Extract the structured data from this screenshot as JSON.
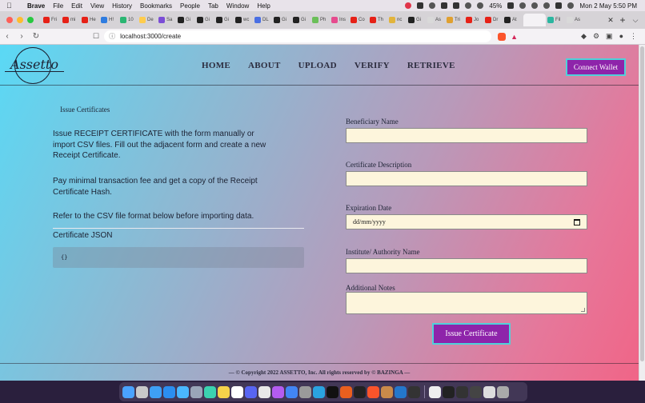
{
  "menubar": {
    "app": "Brave",
    "items": [
      "File",
      "Edit",
      "View",
      "History",
      "Bookmarks",
      "People",
      "Tab",
      "Window",
      "Help"
    ],
    "battery": "45%",
    "datetime": "Mon 2 May  5:50 PM"
  },
  "browser": {
    "tab_labels": [
      "Fri",
      "mi",
      "He",
      "H!",
      "10",
      "De",
      "Sa",
      "Gi",
      "Gi",
      "Gi",
      "wc",
      "DL",
      "Gi",
      "Gi",
      "Ph",
      "Ins",
      "Co",
      "Th",
      "nc",
      "Gi",
      "As",
      "Tri",
      "Jo",
      "Dr",
      "At",
      "",
      "Fil",
      "As"
    ],
    "tab_colors": [
      "#e62117",
      "#e62117",
      "#e62117",
      "#2f7ce0",
      "#2bb673",
      "#ffcc4d",
      "#7b4dd6",
      "#222222",
      "#222222",
      "#222222",
      "#222222",
      "#4a6fe3",
      "#222222",
      "#222222",
      "#6bbf59",
      "#e64b8e",
      "#e62117",
      "#e62117",
      "#e2b43c",
      "#222222",
      "#d9d9d9",
      "#e0a030",
      "#e62117",
      "#e62117",
      "#222222",
      "#f4f2f5",
      "#2bb6a0",
      "#d9d9d9"
    ],
    "url": "localhost:3000/create"
  },
  "navbar": {
    "logo_text": "Assetto",
    "links": [
      "HOME",
      "ABOUT",
      "UPLOAD",
      "VERIFY",
      "RETRIEVE"
    ],
    "connect_label": "Connect Wallet"
  },
  "left": {
    "title": "Issue Certificates",
    "p1": "Issue RECEIPT CERTIFICATE with the form manually or import CSV files. Fill out the adjacent form and create a new Receipt Certificate.",
    "p2": "Pay minimal transaction fee and get a copy of the Receipt Certificate Hash.",
    "p3": "Refer to the CSV file format below before importing data.",
    "json_label": "Certificate JSON",
    "json_value": "{}"
  },
  "form": {
    "beneficiary_label": "Beneficiary Name",
    "beneficiary_value": "",
    "description_label": "Certificate Description",
    "description_value": "",
    "expiration_label": "Expiration Date",
    "expiration_placeholder": "dd/mm/yyyy",
    "institute_label": "Institute/ Authority Name",
    "institute_value": "",
    "notes_label": "Additional Notes",
    "notes_value": "",
    "submit_label": "Issue Certificate"
  },
  "footer": {
    "text": "— © Copyright 2022 ASSETTO, Inc. All rights reserved by © BAZINGA —"
  },
  "colors": {
    "accent": "#8e24aa",
    "accent_border": "#4fd1d9",
    "field_bg": "#fdf5dc"
  },
  "dock": {
    "apps": [
      "#4aa3ff",
      "#c9c9c9",
      "#3ea0f5",
      "#2b8ef0",
      "#4ab7ff",
      "#9aa5b8",
      "#3bd3b0",
      "#f6d24a",
      "#ffffff",
      "#5865f2",
      "#e8e8e8",
      "#b45cf0",
      "#4285f4",
      "#9a9a9a",
      "#2aa3e0",
      "#111111",
      "#e95f1e",
      "#222222",
      "#fb542b",
      "#c98a4a",
      "#2477cc",
      "#333333"
    ],
    "recent": [
      "#eeeeee",
      "#222222",
      "#333333",
      "#444444",
      "#dddddd",
      "#aaaaaa"
    ]
  }
}
